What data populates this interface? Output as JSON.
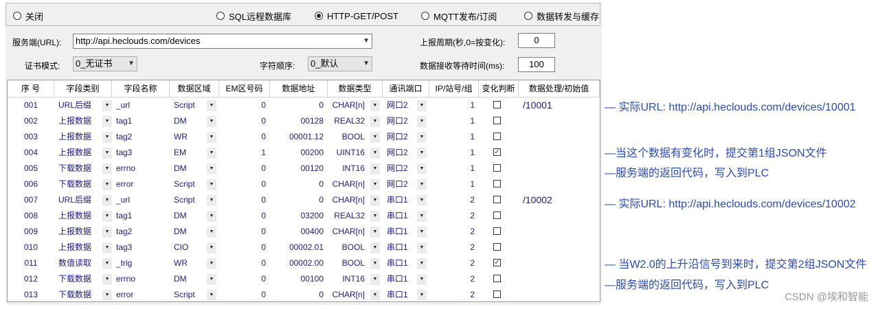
{
  "modes": [
    {
      "label": "关闭",
      "selected": false
    },
    {
      "label": "SQL远程数据库",
      "selected": false
    },
    {
      "label": "HTTP-GET/POST",
      "selected": true
    },
    {
      "label": "MQTT发布/订阅",
      "selected": false
    },
    {
      "label": "数据转发与缓存",
      "selected": false
    }
  ],
  "server": {
    "label": "服务端(URL):",
    "url": "http://api.heclouds.com/devices"
  },
  "period": {
    "label": "上报周期(秒,0=按变化):",
    "value": "0"
  },
  "cert": {
    "label": "证书模式:",
    "value": "0_无证书"
  },
  "byteorder": {
    "label": "字符顺序:",
    "value": "0_默认"
  },
  "timeout": {
    "label": "数据接收等待时间(ms):",
    "value": "100"
  },
  "columns": [
    "序 号",
    "字段类别",
    "字段名称",
    "数据区域",
    "EM区号码",
    "数据地址",
    "数据类型",
    "通讯端口",
    "IP/站号/组",
    "变化判断",
    "数据处理/初始值"
  ],
  "rows": [
    {
      "no": "001",
      "cat": "URL后缀",
      "name": "_url",
      "area": "Script",
      "em": "0",
      "addr": "0",
      "type": "CHAR[n]",
      "port": "网口2",
      "ip": "1",
      "chg": false,
      "proc": "/10001"
    },
    {
      "no": "002",
      "cat": "上报数据",
      "name": "tag1",
      "area": "DM",
      "em": "0",
      "addr": "00128",
      "type": "REAL32",
      "port": "网口2",
      "ip": "1",
      "chg": false,
      "proc": ""
    },
    {
      "no": "003",
      "cat": "上报数据",
      "name": "tag2",
      "area": "WR",
      "em": "0",
      "addr": "00001.12",
      "type": "BOOL",
      "port": "网口2",
      "ip": "1",
      "chg": false,
      "proc": ""
    },
    {
      "no": "004",
      "cat": "上报数据",
      "name": "tag3",
      "area": "EM",
      "em": "1",
      "addr": "00200",
      "type": "UINT16",
      "port": "网口2",
      "ip": "1",
      "chg": true,
      "proc": ""
    },
    {
      "no": "005",
      "cat": "下载数据",
      "name": "errno",
      "area": "DM",
      "em": "0",
      "addr": "00120",
      "type": "INT16",
      "port": "网口2",
      "ip": "1",
      "chg": false,
      "proc": ""
    },
    {
      "no": "006",
      "cat": "下载数据",
      "name": "error",
      "area": "Script",
      "em": "0",
      "addr": "0",
      "type": "CHAR[n]",
      "port": "网口2",
      "ip": "1",
      "chg": false,
      "proc": ""
    },
    {
      "no": "007",
      "cat": "URL后缀",
      "name": "_url",
      "area": "Script",
      "em": "0",
      "addr": "0",
      "type": "CHAR[n]",
      "port": "串口1",
      "ip": "2",
      "chg": false,
      "proc": "/10002"
    },
    {
      "no": "008",
      "cat": "上报数据",
      "name": "tag1",
      "area": "DM",
      "em": "0",
      "addr": "03200",
      "type": "REAL32",
      "port": "串口1",
      "ip": "2",
      "chg": false,
      "proc": ""
    },
    {
      "no": "009",
      "cat": "上报数据",
      "name": "tag2",
      "area": "DM",
      "em": "0",
      "addr": "00400",
      "type": "CHAR[n]",
      "port": "串口1",
      "ip": "2",
      "chg": false,
      "proc": ""
    },
    {
      "no": "010",
      "cat": "上报数据",
      "name": "tag3",
      "area": "CIO",
      "em": "0",
      "addr": "00002.01",
      "type": "BOOL",
      "port": "串口1",
      "ip": "2",
      "chg": false,
      "proc": ""
    },
    {
      "no": "011",
      "cat": "数值读取",
      "name": "_trig",
      "area": "WR",
      "em": "0",
      "addr": "00002.00",
      "type": "BOOL",
      "port": "串口1",
      "ip": "2",
      "chg": true,
      "proc": ""
    },
    {
      "no": "012",
      "cat": "下载数据",
      "name": "errno",
      "area": "DM",
      "em": "0",
      "addr": "00100",
      "type": "INT16",
      "port": "串口1",
      "ip": "2",
      "chg": false,
      "proc": ""
    },
    {
      "no": "013",
      "cat": "下载数据",
      "name": "error",
      "area": "Script",
      "em": "0",
      "addr": "0",
      "type": "CHAR[n]",
      "port": "串口1",
      "ip": "2",
      "chg": false,
      "proc": ""
    }
  ],
  "annotations": [
    "— 实际URL: http://api.heclouds.com/devices/10001",
    "—当这个数据有变化时，提交第1组JSON文件",
    "—服务端的返回代码，写入到PLC",
    "— 实际URL: http://api.heclouds.com/devices/10002",
    "— 当W2.0的上升沿信号到来时，提交第2组JSON文件",
    "—服务端的返回代码，写入到PLC"
  ],
  "watermark": "CSDN @埃和智能"
}
